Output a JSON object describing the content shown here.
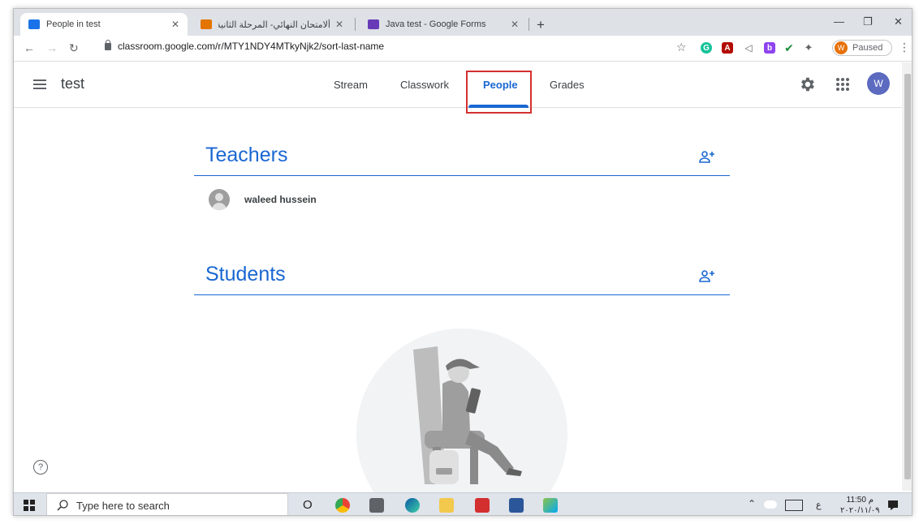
{
  "browser": {
    "tabs": [
      {
        "title": "People in test",
        "active": true,
        "favicon_color": "#1a73e8"
      },
      {
        "title": "ألامتحان النهائي- المرحلة الثانية ok",
        "active": false,
        "favicon_color": "#e37400"
      },
      {
        "title": "Java test - Google Forms",
        "active": false,
        "favicon_color": "#673ab7"
      }
    ],
    "new_tab": "+",
    "url": "classroom.google.com/r/MTY1NDY4MTkyNjk2/sort-last-name",
    "profile_label": "Paused",
    "profile_initial": "W"
  },
  "classroom": {
    "class_name": "test",
    "nav_tabs": [
      "Stream",
      "Classwork",
      "People",
      "Grades"
    ],
    "active_tab": "People",
    "user_initial": "W",
    "accent_color": "#1967d2"
  },
  "sections": {
    "teachers": {
      "title": "Teachers",
      "people": [
        {
          "name": "waleed hussein"
        }
      ]
    },
    "students": {
      "title": "Students",
      "people": []
    }
  },
  "help_icon": "?",
  "taskbar": {
    "search_placeholder": "Type here to search",
    "cortana": "O",
    "keyboard_lang": "ع",
    "time": "11:50 م",
    "date": "٢٠٢٠/١١/٠٩"
  }
}
